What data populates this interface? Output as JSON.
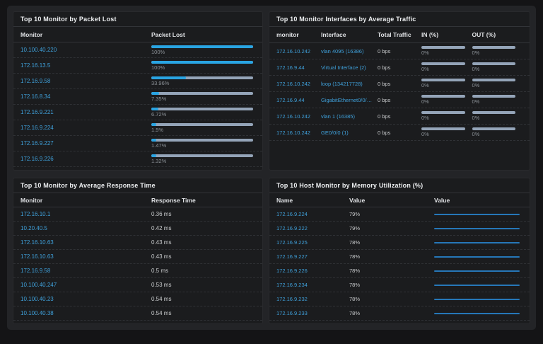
{
  "panels": {
    "packet_lost": {
      "title": "Top 10 Monitor by Packet Lost",
      "columns": [
        "Monitor",
        "Packet Lost"
      ],
      "rows": [
        {
          "monitor": "10.100.40.220",
          "percent": 100,
          "label": "100%"
        },
        {
          "monitor": "172.16.13.5",
          "percent": 100,
          "label": "100%"
        },
        {
          "monitor": "172.16.9.58",
          "percent": 33.96,
          "label": "33.96%"
        },
        {
          "monitor": "172.16.8.34",
          "percent": 7.35,
          "label": "7.35%"
        },
        {
          "monitor": "172.16.9.221",
          "percent": 6.72,
          "label": "6.72%"
        },
        {
          "monitor": "172.16.9.224",
          "percent": 1.5,
          "label": "1.5%"
        },
        {
          "monitor": "172.16.9.227",
          "percent": 1.47,
          "label": "1.47%"
        },
        {
          "monitor": "172.16.9.226",
          "percent": 1.32,
          "label": "1.32%"
        }
      ]
    },
    "avg_traffic": {
      "title": "Top 10 Monitor Interfaces by Average Traffic",
      "columns": [
        "monitor",
        "Interface",
        "Total Traffic",
        "IN (%)",
        "OUT (%)"
      ],
      "rows": [
        {
          "monitor": "172.16.10.242",
          "interface": "vlan 4095 (16386)",
          "total": "0 bps",
          "in_pct": "0%",
          "in_val": 0,
          "out_pct": "0%",
          "out_val": 0
        },
        {
          "monitor": "172.16.9.44",
          "interface": "Virtual Interface (2)",
          "total": "0 bps",
          "in_pct": "0%",
          "in_val": 0,
          "out_pct": "0%",
          "out_val": 0
        },
        {
          "monitor": "172.16.10.242",
          "interface": "loop (134217728)",
          "total": "0 bps",
          "in_pct": "0%",
          "in_val": 0,
          "out_pct": "0%",
          "out_val": 0
        },
        {
          "monitor": "172.16.9.44",
          "interface": "GigabitEthernet0/0/1...",
          "total": "0 bps",
          "in_pct": "0%",
          "in_val": 0,
          "out_pct": "0%",
          "out_val": 0
        },
        {
          "monitor": "172.16.10.242",
          "interface": "vlan 1 (16385)",
          "total": "0 bps",
          "in_pct": "0%",
          "in_val": 0,
          "out_pct": "0%",
          "out_val": 0
        },
        {
          "monitor": "172.16.10.242",
          "interface": "GE0/0/0 (1)",
          "total": "0 bps",
          "in_pct": "0%",
          "in_val": 0,
          "out_pct": "0%",
          "out_val": 0
        }
      ]
    },
    "response_time": {
      "title": "Top 10 Monitor by Average Response Time",
      "columns": [
        "Monitor",
        "Response Time"
      ],
      "rows": [
        {
          "monitor": "172.16.10.1",
          "value": "0.36 ms"
        },
        {
          "monitor": "10.20.40.5",
          "value": "0.42 ms"
        },
        {
          "monitor": "172.16.10.63",
          "value": "0.43 ms"
        },
        {
          "monitor": "172.16.10.63",
          "value": "0.43 ms"
        },
        {
          "monitor": "172.16.9.58",
          "value": "0.5 ms"
        },
        {
          "monitor": "10.100.40.247",
          "value": "0.53 ms"
        },
        {
          "monitor": "10.100.40.23",
          "value": "0.54 ms"
        },
        {
          "monitor": "10.100.40.38",
          "value": "0.54 ms"
        }
      ]
    },
    "memory_util": {
      "title": "Top 10 Host Monitor by Memory Utilization (%)",
      "columns": [
        "Name",
        "Value",
        "Value"
      ],
      "rows": [
        {
          "name": "172.16.9.224",
          "value": "79%"
        },
        {
          "name": "172.16.9.222",
          "value": "79%"
        },
        {
          "name": "172.16.9.225",
          "value": "78%"
        },
        {
          "name": "172.16.9.227",
          "value": "78%"
        },
        {
          "name": "172.16.9.226",
          "value": "78%"
        },
        {
          "name": "172.16.9.234",
          "value": "78%"
        },
        {
          "name": "172.16.9.232",
          "value": "78%"
        },
        {
          "name": "172.16.9.233",
          "value": "78%"
        }
      ]
    }
  },
  "colors": {
    "page_bg": "#141416",
    "board_bg": "#232427",
    "panel_bg": "#1b1c1e",
    "link_blue": "#3fa0da",
    "bar_fill_blue": "#29a4e2",
    "bar_track_gray": "#94a4b8",
    "sparkline_blue": "#2677b8"
  }
}
